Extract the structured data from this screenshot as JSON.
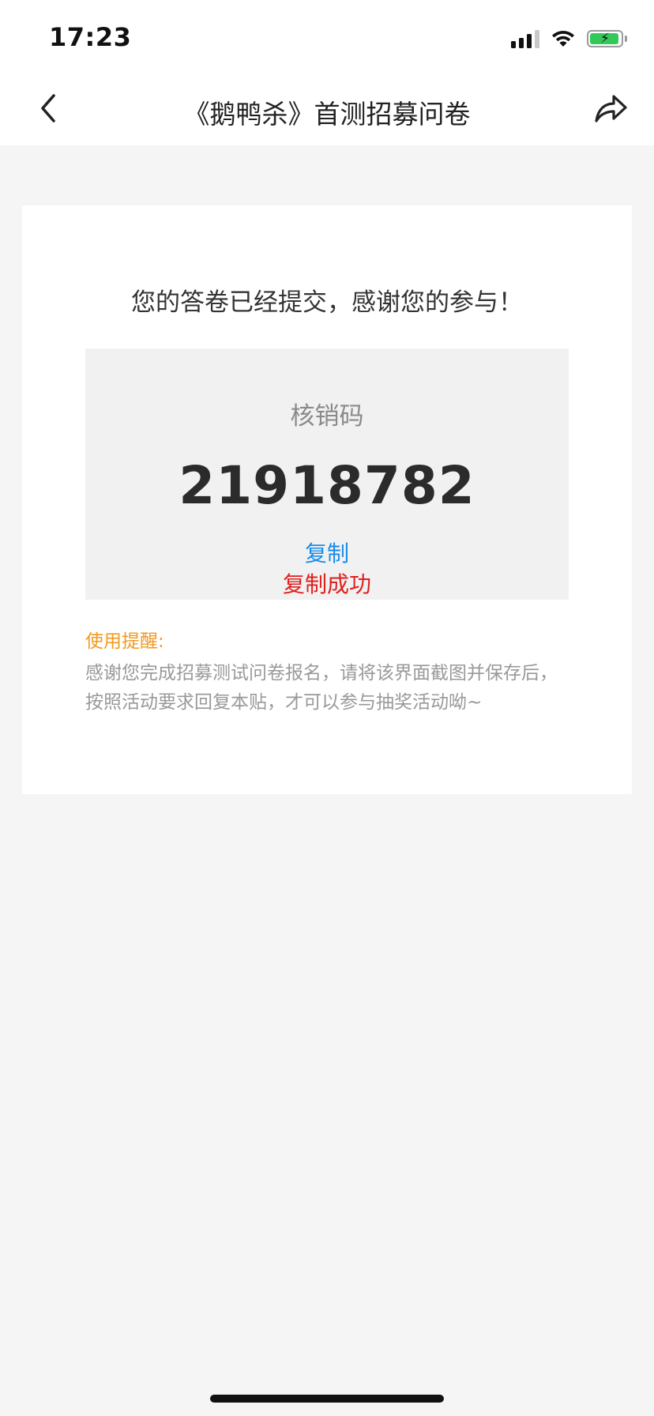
{
  "status_bar": {
    "time": "17:23"
  },
  "nav": {
    "title": "《鹅鸭杀》首测招募问卷"
  },
  "result": {
    "thanks_message": "您的答卷已经提交，感谢您的参与！",
    "code_label": "核销码",
    "code_value": "21918782",
    "copy_label": "复制",
    "copy_success_label": "复制成功"
  },
  "reminder": {
    "title": "使用提醒:",
    "text": "感谢您完成招募测试问卷报名，请将该界面截图并保存后，按照活动要求回复本贴，才可以参与抽奖活动呦~"
  },
  "colors": {
    "page_background": "#f5f5f5",
    "link": "#1a8ce8",
    "success": "#e02020",
    "reminder_title": "#f29a1f",
    "battery": "#34c759"
  },
  "icons": {
    "back": "chevron-left-icon",
    "share": "share-arrow-icon",
    "signal": "cellular-signal-icon",
    "wifi": "wifi-icon",
    "battery": "battery-charging-icon"
  }
}
